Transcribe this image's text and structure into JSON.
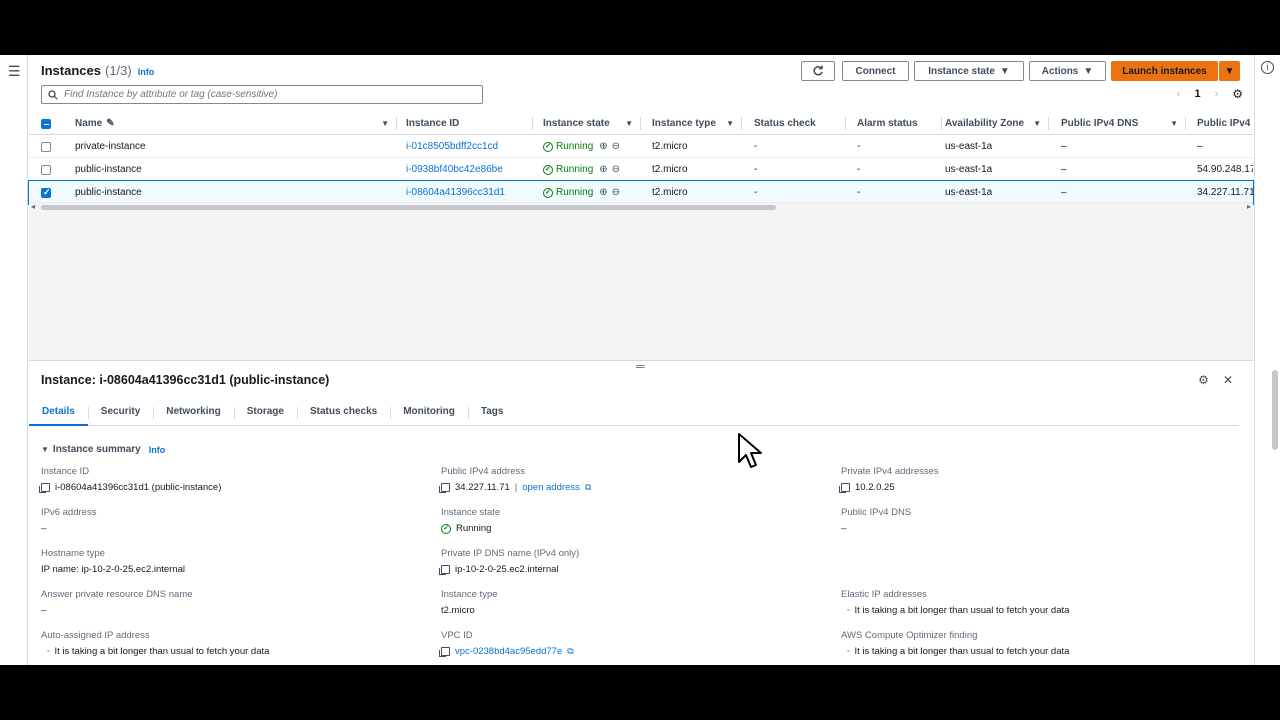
{
  "header": {
    "title": "Instances",
    "count": "(1/3)",
    "info": "Info",
    "refresh_icon": "refresh-icon",
    "connect_label": "Connect",
    "instance_state_label": "Instance state",
    "actions_label": "Actions",
    "launch_label": "Launch instances"
  },
  "search": {
    "placeholder": "Find Instance by attribute or tag (case-sensitive)"
  },
  "pager": {
    "page": "1"
  },
  "columns": [
    "Name",
    "Instance ID",
    "Instance state",
    "Instance type",
    "Status check",
    "Alarm status",
    "Availability Zone",
    "Public IPv4 DNS",
    "Public IPv4 ..."
  ],
  "rows": [
    {
      "name": "private-instance",
      "id": "i-01c8505bdff2cc1cd",
      "state": "Running",
      "type": "t2.micro",
      "status": "-",
      "alarm": "-",
      "az": "us-east-1a",
      "dns": "–",
      "ipv4": "–",
      "selected": false
    },
    {
      "name": "public-instance",
      "id": "i-0938bf40bc42e86be",
      "state": "Running",
      "type": "t2.micro",
      "status": "-",
      "alarm": "-",
      "az": "us-east-1a",
      "dns": "–",
      "ipv4": "54.90.248.17",
      "selected": false
    },
    {
      "name": "public-instance",
      "id": "i-08604a41396cc31d1",
      "state": "Running",
      "type": "t2.micro",
      "status": "-",
      "alarm": "-",
      "az": "us-east-1a",
      "dns": "–",
      "ipv4": "34.227.11.71",
      "selected": true
    }
  ],
  "details": {
    "title": "Instance: i-08604a41396cc31d1 (public-instance)",
    "tabs": [
      "Details",
      "Security",
      "Networking",
      "Storage",
      "Status checks",
      "Monitoring",
      "Tags"
    ],
    "summary_label": "Instance summary",
    "summary_info": "Info",
    "fields": {
      "instance_id_k": "Instance ID",
      "instance_id_v": "i-08604a41396cc31d1 (public-instance)",
      "ipv6_k": "IPv6 address",
      "ipv6_v": "–",
      "hostname_k": "Hostname type",
      "hostname_v": "IP name: ip-10-2-0-25.ec2.internal",
      "answer_k": "Answer private resource DNS name",
      "answer_v": "–",
      "autoip_k": "Auto-assigned IP address",
      "autoip_v": "It is taking a bit longer than usual to fetch your data",
      "pubip_k": "Public IPv4 address",
      "pubip_v": "34.227.11.71",
      "open_address": "open address",
      "state_k": "Instance state",
      "state_v": "Running",
      "privdns_k": "Private IP DNS name (IPv4 only)",
      "privdns_v": "ip-10-2-0-25.ec2.internal",
      "type_k": "Instance type",
      "type_v": "t2.micro",
      "vpc_k": "VPC ID",
      "vpc_v": "vpc-0238bd4ac95edd77e",
      "privip_k": "Private IPv4 addresses",
      "privip_v": "10.2.0.25",
      "pubdns_k": "Public IPv4 DNS",
      "pubdns_v": "–",
      "elastic_k": "Elastic IP addresses",
      "elastic_v": "It is taking a bit longer than usual to fetch your data",
      "optimizer_k": "AWS Compute Optimizer finding",
      "optimizer_v": "It is taking a bit longer than usual to fetch your data"
    }
  },
  "colors": {
    "accent": "#0972d3",
    "primary_button": "#ec7211",
    "running": "#037f0c"
  }
}
